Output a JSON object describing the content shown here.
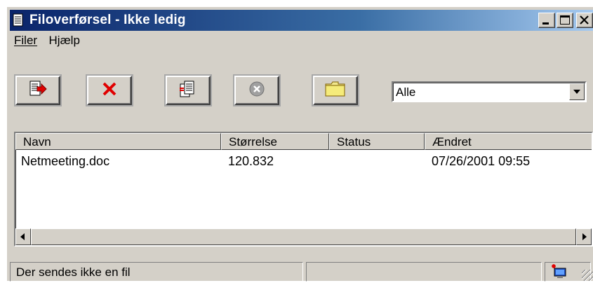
{
  "window": {
    "title": "Filoverførsel - Ikke ledig",
    "title_color_start": "#0a246a",
    "title_color_end": "#a6caf0"
  },
  "menu": {
    "items": [
      {
        "label": "Filer"
      },
      {
        "label": "Hjælp"
      }
    ]
  },
  "toolbar": {
    "buttons": [
      {
        "icon": "send-file-icon"
      },
      {
        "icon": "delete-icon"
      },
      {
        "icon": "copy-file-icon"
      },
      {
        "icon": "cancel-circle-icon"
      },
      {
        "icon": "folder-icon"
      }
    ],
    "filter": {
      "value": "Alle"
    }
  },
  "list": {
    "columns": [
      "Navn",
      "Størrelse",
      "Status",
      "Ændret"
    ],
    "rows": [
      {
        "name": "Netmeeting.doc",
        "size": "120.832",
        "status": "",
        "modified": "07/26/2001  09:55"
      }
    ]
  },
  "status": {
    "text": "Der sendes ikke en fil"
  }
}
